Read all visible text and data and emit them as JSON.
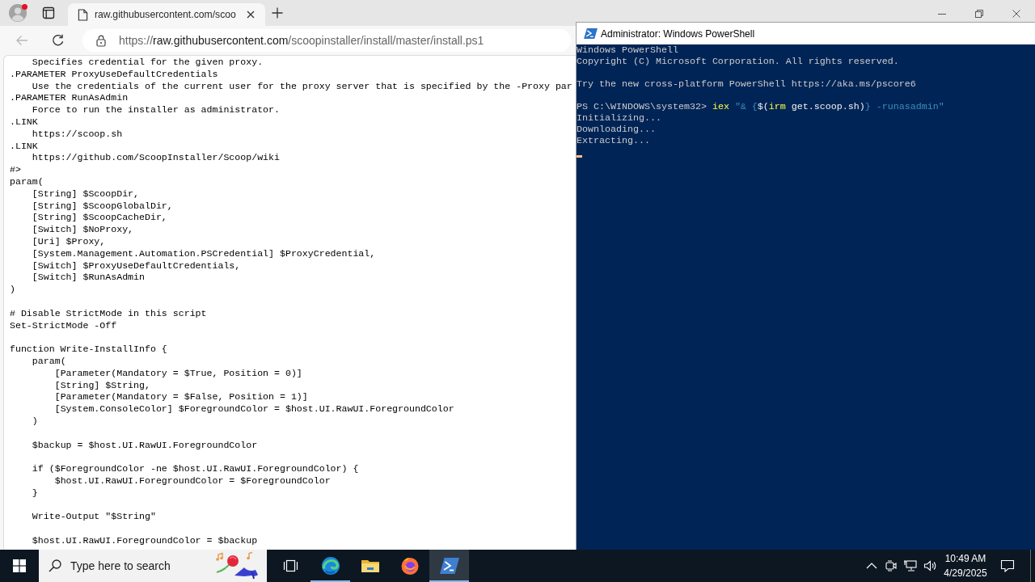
{
  "browser": {
    "profile": {
      "notification": true
    },
    "tabs": [
      {
        "title": "raw.githubusercontent.com/scoo",
        "selected": true
      }
    ],
    "back": {
      "disabled": true
    },
    "address": {
      "scheme": "https://",
      "host": "raw.githubusercontent.com",
      "path": "/scoopinstaller/install/master/install.ps1"
    },
    "code_blocks": [
      [
        "    Specifies credential for the given proxy.",
        ".PARAMETER ProxyUseDefaultCredentials",
        "    Use the credentials of the current user for the proxy server that is specified by the -Proxy par",
        ".PARAMETER RunAsAdmin",
        "    Force to run the installer as administrator.",
        ".LINK",
        "    https://scoop.sh",
        ".LINK",
        "    https://github.com/ScoopInstaller/Scoop/wiki",
        "#>",
        "param(",
        "    [String] $ScoopDir,",
        "    [String] $ScoopGlobalDir,",
        "    [String] $ScoopCacheDir,",
        "    [Switch] $NoProxy,",
        "    [Uri] $Proxy,",
        "    [System.Management.Automation.PSCredential] $ProxyCredential,",
        "    [Switch] $ProxyUseDefaultCredentials,",
        "    [Switch] $RunAsAdmin",
        ")"
      ],
      [
        "# Disable StrictMode in this script",
        "Set-StrictMode -Off"
      ],
      [
        "function Write-InstallInfo {",
        "    param(",
        "        [Parameter(Mandatory = $True, Position = 0)]",
        "        [String] $String,",
        "        [Parameter(Mandatory = $False, Position = 1)]",
        "        [System.ConsoleColor] $ForegroundColor = $host.UI.RawUI.ForegroundColor",
        "    )"
      ],
      [
        "    $backup = $host.UI.RawUI.ForegroundColor"
      ],
      [
        "    if ($ForegroundColor -ne $host.UI.RawUI.ForegroundColor) {",
        "        $host.UI.RawUI.ForegroundColor = $ForegroundColor",
        "    }"
      ],
      [
        "    Write-Output \"$String\""
      ],
      [
        "    $host.UI.RawUI.ForegroundColor = $backup"
      ]
    ]
  },
  "powershell": {
    "title": "Administrator: Windows PowerShell",
    "console": {
      "banner": [
        "Windows PowerShell",
        "Copyright (C) Microsoft Corporation. All rights reserved."
      ],
      "notice": "Try the new cross-platform PowerShell https://aka.ms/pscore6",
      "prompt": "PS C:\\WINDOWS\\system32>",
      "command": [
        {
          "text": "iex ",
          "kind": "keyword"
        },
        {
          "text": "\"& {",
          "kind": "string"
        },
        {
          "text": "$(",
          "kind": "text"
        },
        {
          "text": "irm ",
          "kind": "keyword"
        },
        {
          "text": "get.scoop.sh)",
          "kind": "text"
        },
        {
          "text": "} -runasadmin\"",
          "kind": "string"
        }
      ],
      "output": [
        "Initializing...",
        "Downloading...",
        "Extracting..."
      ]
    }
  },
  "taskbar": {
    "search": {
      "placeholder": "Type here to search"
    },
    "apps": [
      {
        "kind": "edge",
        "running": true,
        "selected": false
      },
      {
        "kind": "folder",
        "running": false,
        "selected": false
      },
      {
        "kind": "firefox",
        "running": false,
        "selected": false
      },
      {
        "kind": "terminal",
        "running": true,
        "selected": true
      }
    ],
    "clock": {
      "time": "10:49 AM",
      "date": "4/29/2025"
    }
  }
}
